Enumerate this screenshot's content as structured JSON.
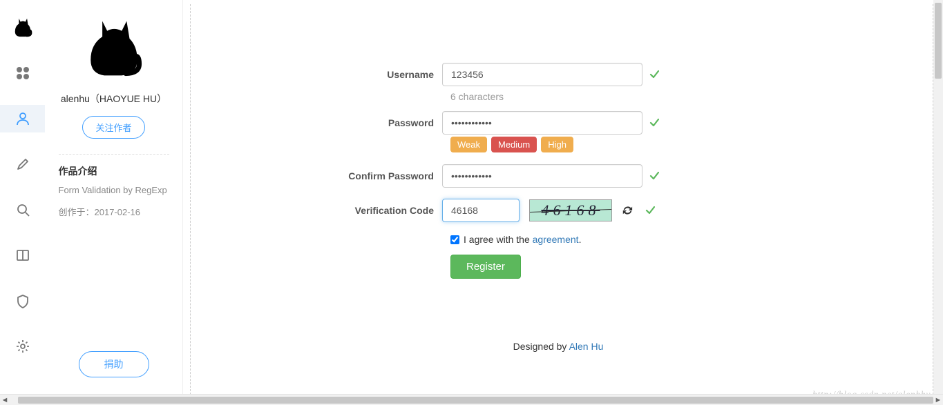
{
  "rail": [
    "logo",
    "grid",
    "user",
    "pen",
    "search",
    "book",
    "shield",
    "gear"
  ],
  "sidebar": {
    "author_name": "alenhu（HAOYUE HU）",
    "follow_label": "关注作者",
    "intro_title": "作品介绍",
    "intro_sub": "Form Validation by RegExp",
    "intro_date": "创作于：2017-02-16",
    "donate_label": "捐助"
  },
  "form": {
    "username_label": "Username",
    "username_value": "123456",
    "username_hint": "6 characters",
    "password_label": "Password",
    "password_value": "••••••••••••",
    "confirm_label": "Confirm Password",
    "confirm_value": "••••••••••••",
    "strength": {
      "weak": "Weak",
      "medium": "Medium",
      "high": "High"
    },
    "code_label": "Verification Code",
    "code_value": "46168",
    "captcha_text": "46168",
    "agree_prefix": "I agree with the ",
    "agree_link": "agreement",
    "agree_suffix": ".",
    "register_label": "Register"
  },
  "footer": {
    "prefix": "Designed by ",
    "author": "Alen Hu"
  },
  "watermark": "http://blog.csdn.net/alenhhy"
}
